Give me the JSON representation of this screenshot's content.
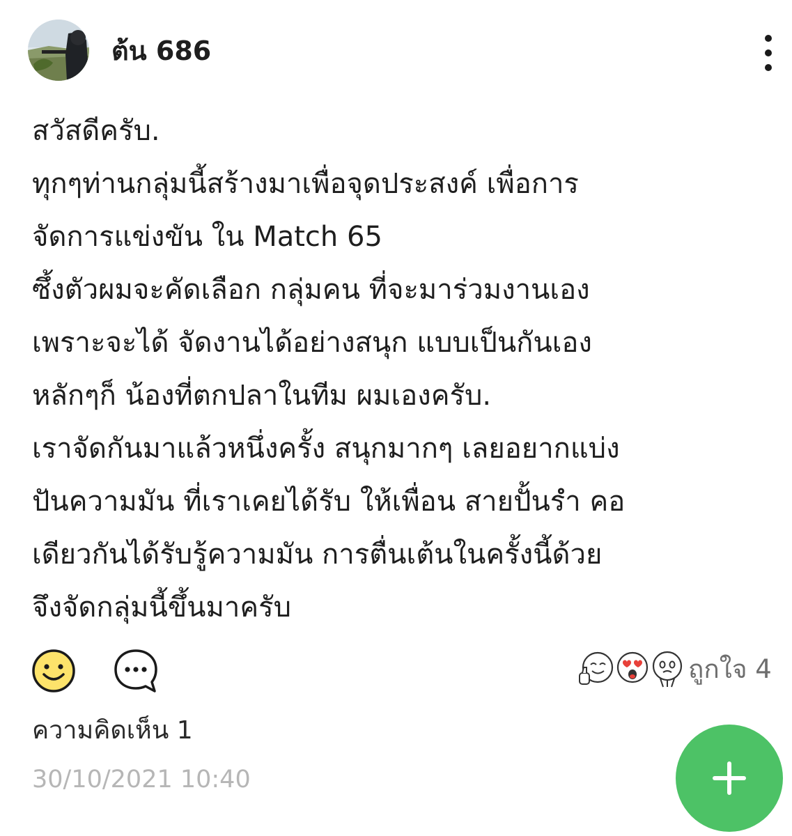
{
  "post": {
    "author_name": "ต้น 686",
    "body_lines": [
      "สวัสดีครับ.",
      "ทุกๆท่านกลุ่มนี้สร้างมาเพื่อจุดประสงค์ เพื่อการ",
      "จัดการแข่งขัน ใน Match 65",
      "ซึ้งตัวผมจะคัดเลือก กลุ่มคน ที่จะมาร่วมงานเอง",
      "เพราะจะได้ จัดงานได้อย่างสนุก แบบเป็นกันเอง",
      "หลักๆก็ น้องที่ตกปลาในทีม ผมเองครับ.",
      "เราจัดกันมาแล้วหนึ่งครั้ง สนุกมากๆ เลยอยากแบ่ง",
      "ปันความมัน ที่เราเคยได้รับ ให้เพื่อน สายปั้นรำ คอ",
      "เดียวกันได้รับรู้ความมัน การตื่นเต้นในครั้งนี้ด้วย",
      "จึงจัดกลุ่มนี้ขึ้นมาครับ"
    ],
    "like_label": "ถูกใจ 4",
    "comments_label": "ความคิดเห็น 1",
    "timestamp": "30/10/2021 10:40"
  },
  "icons": {
    "avatar": "avatar-photo",
    "more": "more-vertical-icon",
    "react": "smiley-icon",
    "comment": "comment-bubble-icon",
    "reactions": [
      "thumbs-up-face-icon",
      "heart-eyes-face-icon",
      "crying-face-icon"
    ],
    "fab": "plus-icon"
  },
  "colors": {
    "accent_green": "#4dc266",
    "emoji_yellow": "#fde36b",
    "timestamp_gray": "#b6b6b6",
    "secondary_text": "#6e6e6e"
  }
}
